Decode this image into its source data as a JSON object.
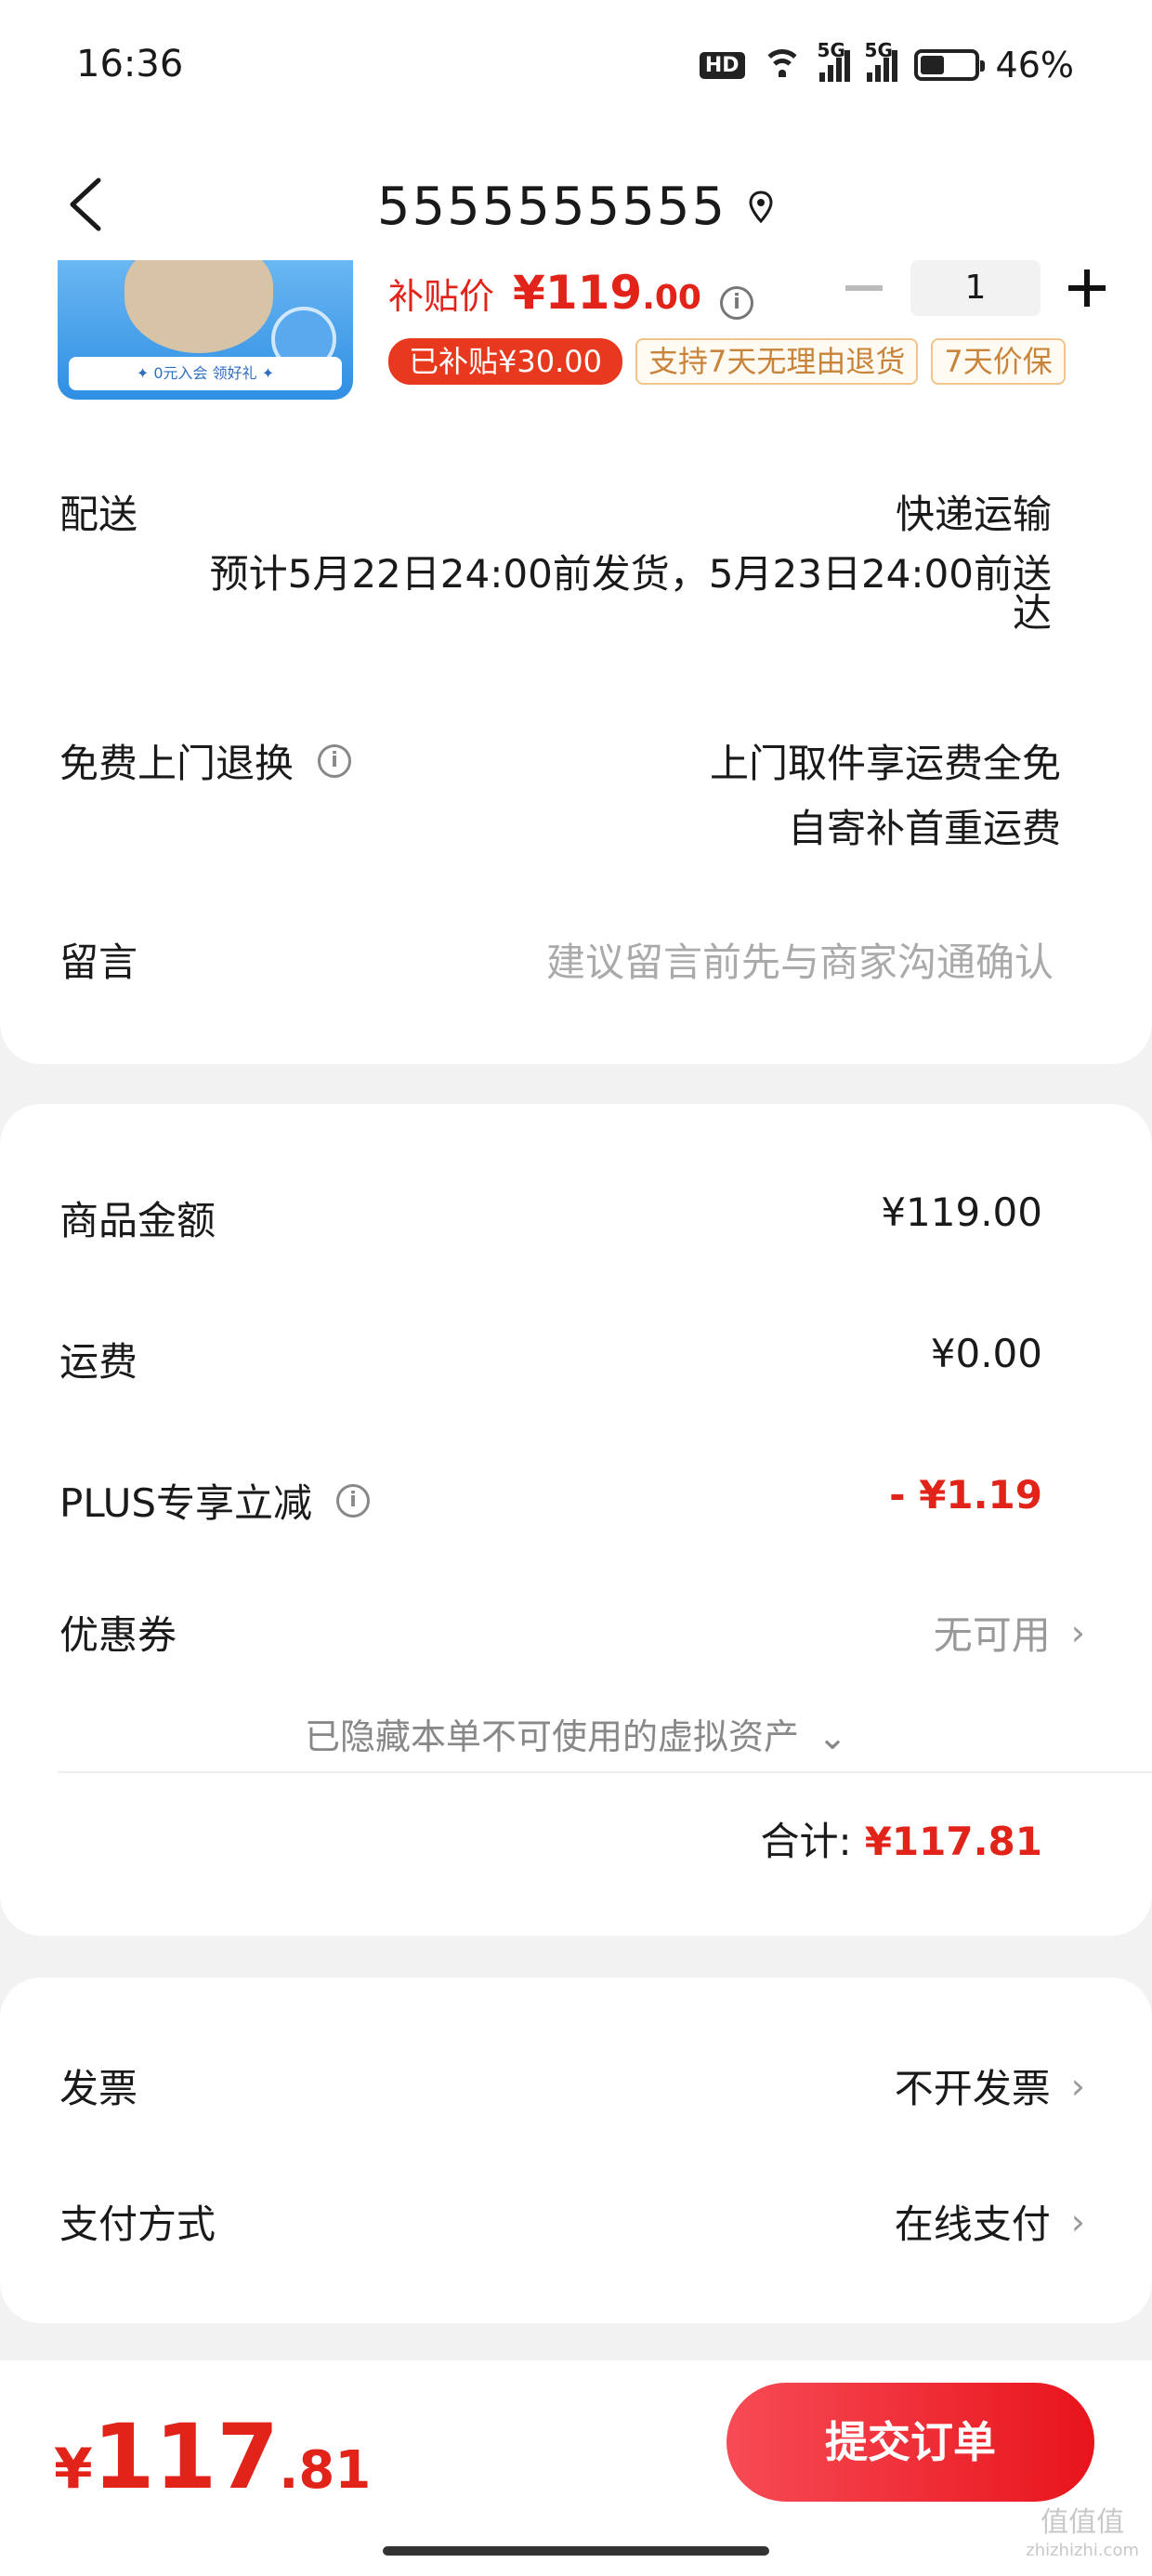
{
  "status_bar": {
    "time": "16:36",
    "hd_badge": "HD",
    "signal1_label": "5G",
    "signal2_label": "5G",
    "battery": "46%",
    "battery_level": 0.46
  },
  "header": {
    "title": "5555555555"
  },
  "product": {
    "thumb_strip": "✦ 0元入会 领好礼 ✦",
    "price_label": "补贴价",
    "price_currency": "¥",
    "price_int": "119",
    "price_dec": ".00",
    "quantity": "1",
    "tags": [
      "已补贴¥30.00",
      "支持7天无理由退货",
      "7天价保"
    ]
  },
  "delivery": {
    "label": "配送",
    "method": "快递运输",
    "estimate_line1": "预计5月22日24:00前发货，5月23日24:00前送",
    "estimate_line2": "达"
  },
  "return_service": {
    "label": "免费上门退换",
    "line1": "上门取件享运费全免",
    "line2": "自寄补首重运费"
  },
  "message": {
    "label": "留言",
    "placeholder": "建议留言前先与商家沟通确认"
  },
  "summary": {
    "goods_label": "商品金额",
    "goods_value": "¥119.00",
    "shipping_label": "运费",
    "shipping_value": "¥0.00",
    "plus_label": "PLUS专享立减",
    "plus_value": "- ¥1.19",
    "coupon_label": "优惠券",
    "coupon_value": "无可用",
    "hidden_assets": "已隐藏本单不可使用的虚拟资产",
    "total_label": "合计:",
    "total_value": "¥117.81"
  },
  "invoice": {
    "label": "发票",
    "value": "不开发票"
  },
  "payment": {
    "label": "支付方式",
    "value": "在线支付"
  },
  "footer": {
    "total_currency": "¥",
    "total_int": "117",
    "total_dec": ".81",
    "submit_label": "提交订单"
  },
  "watermark": {
    "main": "值值值",
    "sub": "zhizhizhi.com"
  },
  "colors": {
    "accent_red": "#e2231a",
    "tag_orange": "#c8843a"
  }
}
